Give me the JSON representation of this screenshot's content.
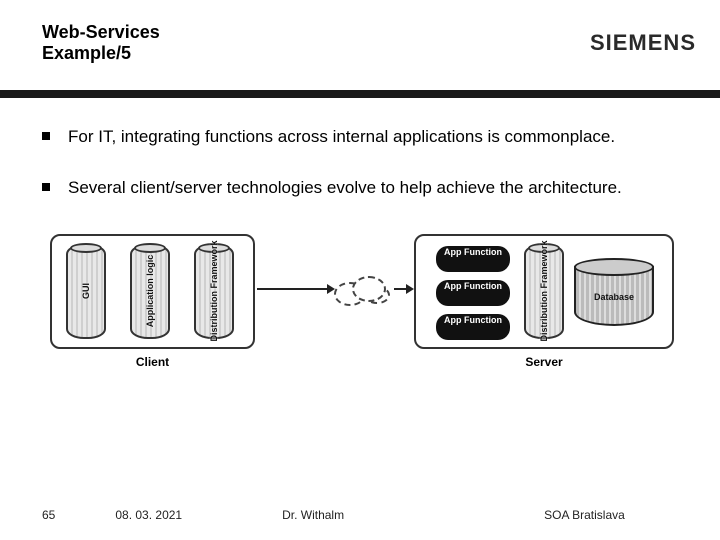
{
  "header": {
    "title_line1": "Web-Services",
    "title_line2": "Example/5",
    "logo_text": "SIEMENS"
  },
  "bullets": [
    "For IT, integrating functions across internal applications is commonplace.",
    "Several client/server technologies evolve to help achieve the architecture."
  ],
  "diagram": {
    "client_caption": "Client",
    "server_caption": "Server",
    "client_cols": [
      "GUI",
      "Application logic",
      "Distribution Framework"
    ],
    "server_col": "Distribution Framework",
    "app_fn_label": "App Function",
    "db_label": "Database"
  },
  "footer": {
    "page": "65",
    "date": "08. 03. 2021",
    "author": "Dr. Withalm",
    "event": "SOA Bratislava"
  }
}
